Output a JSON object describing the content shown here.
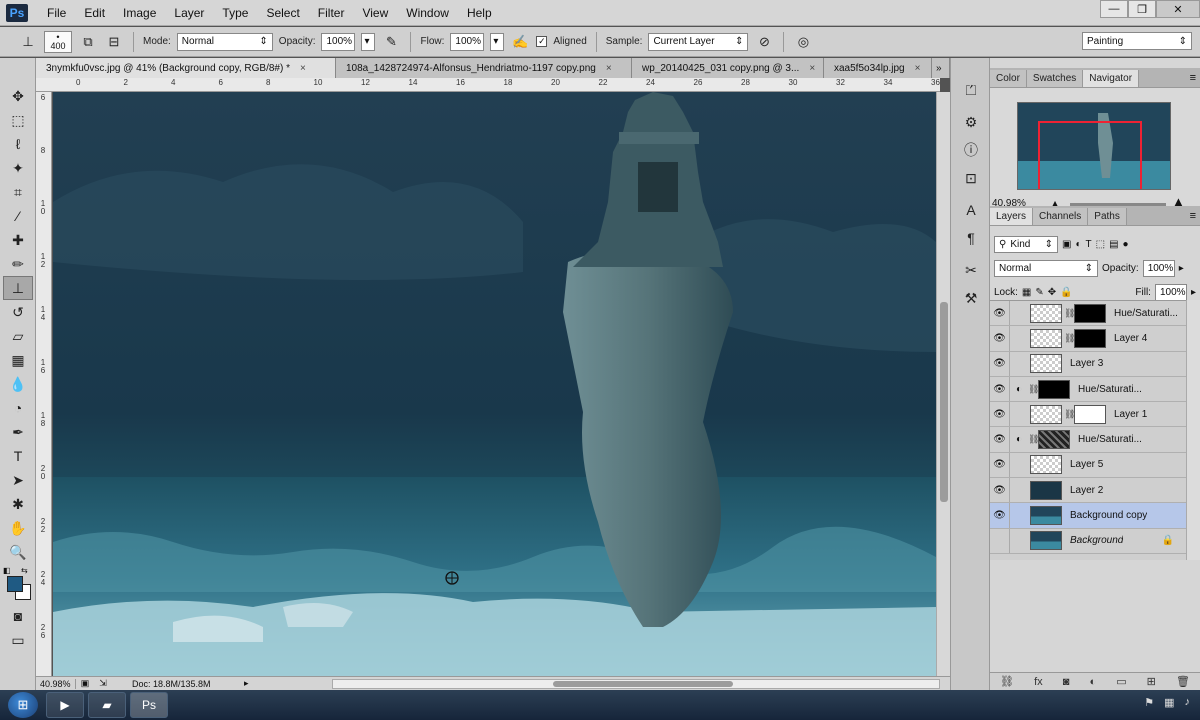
{
  "app": {
    "logo": "Ps"
  },
  "menu": [
    "File",
    "Edit",
    "Image",
    "Layer",
    "Type",
    "Select",
    "Filter",
    "View",
    "Window",
    "Help"
  ],
  "window_controls": {
    "minimize": "—",
    "restore": "❐",
    "close": "✕"
  },
  "options": {
    "brush_size": "400",
    "mode_label": "Mode:",
    "mode_value": "Normal",
    "opacity_label": "Opacity:",
    "opacity_value": "100%",
    "flow_label": "Flow:",
    "flow_value": "100%",
    "aligned_label": "Aligned",
    "aligned_checked": true,
    "sample_label": "Sample:",
    "sample_value": "Current Layer",
    "workspace": "Painting"
  },
  "tabs": [
    {
      "label": "3nymkfu0vsc.jpg @ 41% (Background copy, RGB/8#) *",
      "active": true
    },
    {
      "label": "108a_1428724974-Alfonsus_Hendriatmo-1197 copy.png",
      "active": false
    },
    {
      "label": "wp_20140425_031 copy.png @ 3...",
      "active": false
    },
    {
      "label": "xaa5f5o34lp.jpg",
      "active": false
    }
  ],
  "tabs_overflow": "»",
  "ruler_top": [
    "0",
    "2",
    "4",
    "6",
    "8",
    "10",
    "12",
    "14",
    "16",
    "18",
    "20",
    "22",
    "24",
    "26",
    "28",
    "30",
    "32",
    "34",
    "36"
  ],
  "ruler_left": [
    "6",
    "8",
    "10",
    "12",
    "14",
    "16",
    "18",
    "20",
    "22",
    "24",
    "26"
  ],
  "status": {
    "zoom": "40.98%",
    "doc": "Doc: 18.8M/135.8M"
  },
  "panels": {
    "top_tabs": [
      "Color",
      "Swatches",
      "Navigator"
    ],
    "navigator_zoom": "40.98%",
    "layer_tabs": [
      "Layers",
      "Channels",
      "Paths"
    ],
    "filter_label": "Kind",
    "blend_mode": "Normal",
    "opacity_label": "Opacity:",
    "opacity_value": "100%",
    "lock_label": "Lock:",
    "fill_label": "Fill:",
    "fill_value": "100%"
  },
  "layers": [
    {
      "name": "Hue/Saturati...",
      "visible": true,
      "adjustment": true,
      "thumb": "checker",
      "mask": "black",
      "italic": false,
      "selected": false,
      "locked": false
    },
    {
      "name": "Layer 4",
      "visible": true,
      "adjustment": true,
      "thumb": "checker",
      "mask": "black",
      "italic": false,
      "selected": false,
      "locked": false
    },
    {
      "name": "Layer 3",
      "visible": true,
      "adjustment": false,
      "thumb": "checker",
      "mask": "none",
      "italic": false,
      "selected": false,
      "locked": false
    },
    {
      "name": "Hue/Saturati...",
      "visible": true,
      "adjustment": true,
      "thumb": "none",
      "mask": "black",
      "italic": false,
      "selected": false,
      "locked": false
    },
    {
      "name": "Layer 1",
      "visible": true,
      "adjustment": false,
      "thumb": "checker",
      "mask": "white",
      "italic": false,
      "selected": false,
      "locked": false
    },
    {
      "name": "Hue/Saturati...",
      "visible": true,
      "adjustment": true,
      "thumb": "none",
      "mask": "noise",
      "italic": false,
      "selected": false,
      "locked": false
    },
    {
      "name": "Layer 5",
      "visible": true,
      "adjustment": false,
      "thumb": "checker",
      "mask": "none",
      "italic": false,
      "selected": false,
      "locked": false
    },
    {
      "name": "Layer 2",
      "visible": true,
      "adjustment": false,
      "thumb": "dark",
      "mask": "none",
      "italic": false,
      "selected": false,
      "locked": false
    },
    {
      "name": "Background copy",
      "visible": true,
      "adjustment": false,
      "thumb": "scene",
      "mask": "none",
      "italic": false,
      "selected": true,
      "locked": false
    },
    {
      "name": "Background",
      "visible": false,
      "adjustment": false,
      "thumb": "scene",
      "mask": "none",
      "italic": true,
      "selected": false,
      "locked": true
    }
  ],
  "taskbar": {
    "start": "⊞"
  },
  "colors": {
    "foreground": "#1f5a83",
    "background": "#ffffff"
  }
}
